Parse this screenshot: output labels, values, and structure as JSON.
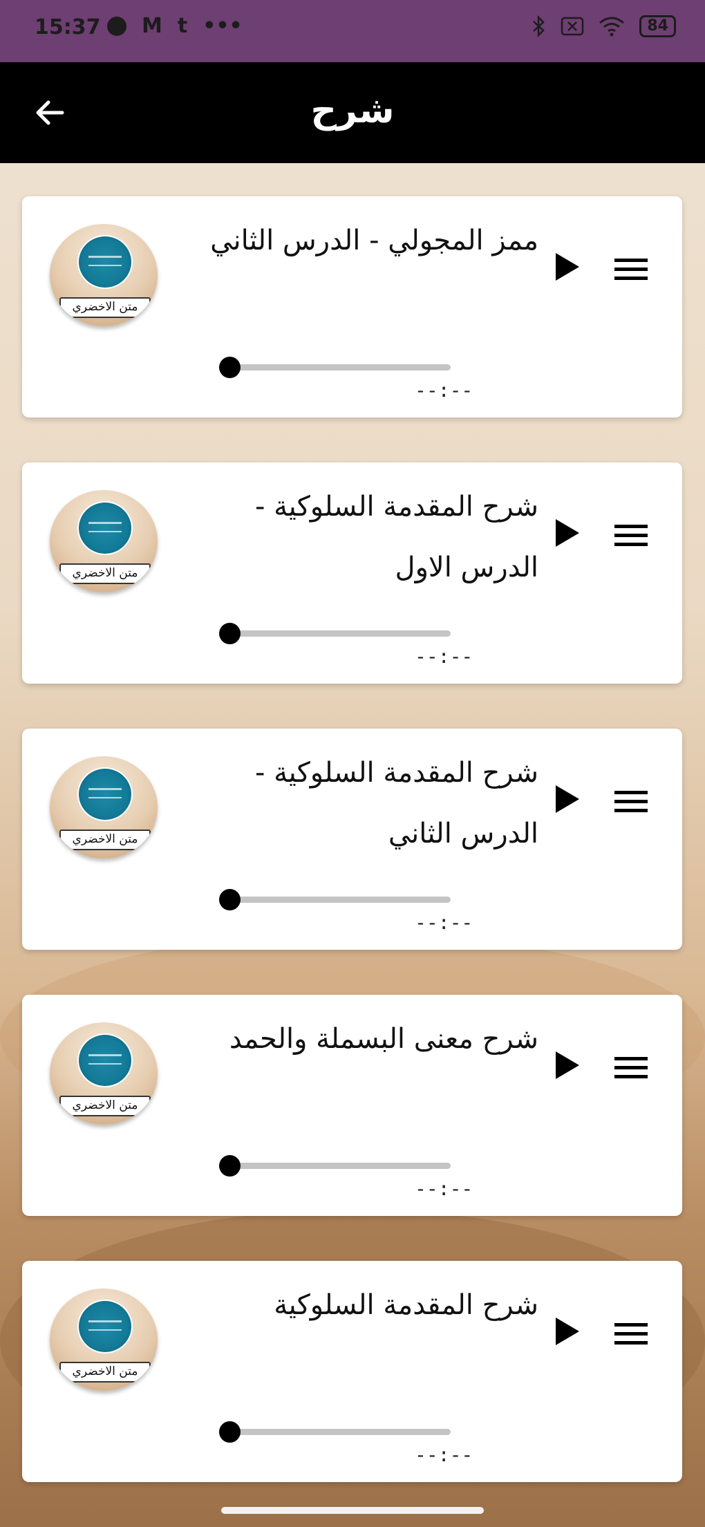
{
  "status_bar": {
    "time": "15:37",
    "left_icons": [
      "opera-icon",
      "m-icon",
      "t-icon",
      "more-dots-icon"
    ],
    "battery": "84",
    "right_icons": [
      "bluetooth-icon",
      "no-sim-icon",
      "wifi-icon",
      "battery-icon"
    ],
    "background": "#6e3f72"
  },
  "app_bar": {
    "title": "شرح",
    "back_icon": "arrow-left-icon",
    "background": "#000000"
  },
  "cards": [
    {
      "title": "ممز المجولي  - الدرس الثاني",
      "badge": "متن الاخضري",
      "time": "--:--",
      "progress": 0
    },
    {
      "title": "شرح المقدمة السلوكية - الدرس الاول",
      "badge": "متن الاخضري",
      "time": "--:--",
      "progress": 0
    },
    {
      "title": "شرح المقدمة السلوكية - الدرس الثاني",
      "badge": "متن الاخضري",
      "time": "--:--",
      "progress": 0
    },
    {
      "title": "شرح معنى البسملة والحمد",
      "badge": "متن الاخضري",
      "time": "--:--",
      "progress": 0
    },
    {
      "title": "شرح المقدمة السلوكية",
      "badge": "متن الاخضري",
      "time": "--:--",
      "progress": 0
    }
  ]
}
